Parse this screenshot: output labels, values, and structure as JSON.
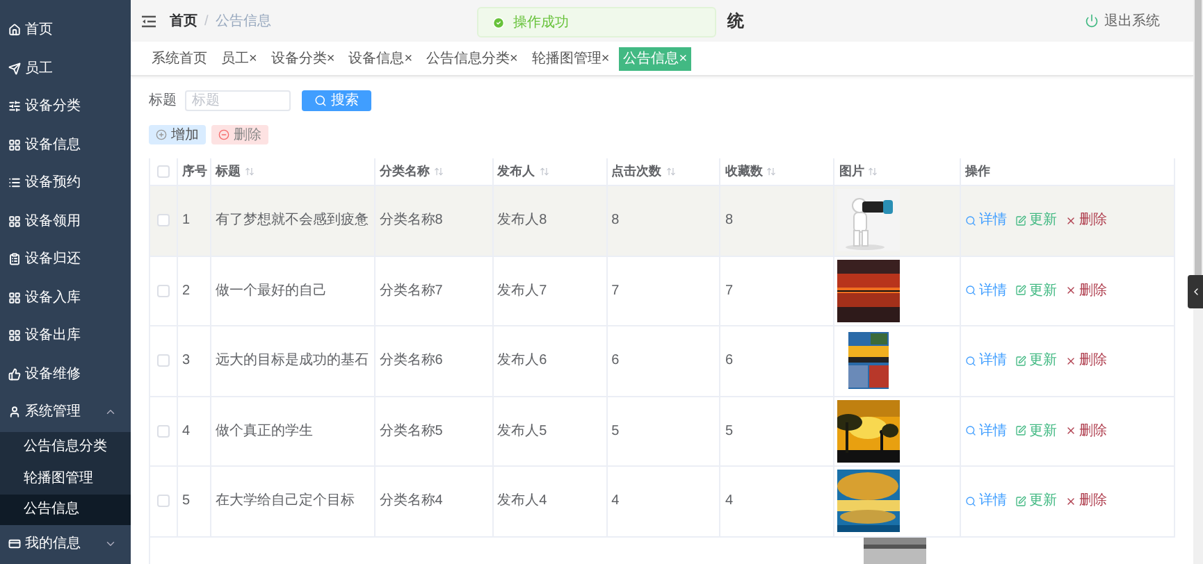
{
  "sidebar": {
    "items": [
      {
        "label": "首页",
        "selected": false
      },
      {
        "label": "员工",
        "selected": false
      },
      {
        "label": "设备分类",
        "selected": false
      },
      {
        "label": "设备信息",
        "selected": false
      },
      {
        "label": "设备预约",
        "selected": false
      },
      {
        "label": "设备领用",
        "selected": false
      },
      {
        "label": "设备归还",
        "selected": false
      },
      {
        "label": "设备入库",
        "selected": false
      },
      {
        "label": "设备出库",
        "selected": false
      },
      {
        "label": "设备维修",
        "selected": false
      },
      {
        "label": "系统管理",
        "selected": false,
        "expanded": true,
        "children": [
          {
            "label": "公告信息分类",
            "selected": false
          },
          {
            "label": "轮播图管理",
            "selected": false
          },
          {
            "label": "公告信息",
            "selected": true
          }
        ]
      },
      {
        "label": "我的信息",
        "selected": false,
        "expanded": false
      }
    ]
  },
  "header": {
    "breadcrumb": [
      {
        "label": "首页",
        "current": false
      },
      {
        "label": "公告信息",
        "current": true
      }
    ],
    "separator": "/",
    "title": "统",
    "logout": "退出系统"
  },
  "toast": {
    "message": "操作成功"
  },
  "tabs": [
    {
      "label": "系统首页",
      "selected": false
    },
    {
      "label": "员工",
      "close": "×",
      "selected": false
    },
    {
      "label": "设备分类",
      "close": "×",
      "selected": false
    },
    {
      "label": "设备信息",
      "close": "×",
      "selected": false
    },
    {
      "label": "公告信息分类",
      "close": "×",
      "selected": false
    },
    {
      "label": "轮播图管理",
      "close": "×",
      "selected": false
    },
    {
      "label": "公告信息",
      "close": "×",
      "selected": true
    }
  ],
  "search": {
    "label": "标题",
    "placeholder": "标题",
    "button": "搜索"
  },
  "toolbar": {
    "add": "增加",
    "delete": "删除"
  },
  "table": {
    "select_all_checked": false,
    "columns": [
      {
        "label": "序号",
        "sortable": false
      },
      {
        "label": "标题",
        "sortable": true
      },
      {
        "label": "分类名称",
        "sortable": true
      },
      {
        "label": "发布人",
        "sortable": true
      },
      {
        "label": "点击次数",
        "sortable": true
      },
      {
        "label": "收藏数",
        "sortable": true
      },
      {
        "label": "图片",
        "sortable": true
      },
      {
        "label": "操作",
        "sortable": false
      }
    ],
    "rows": [
      {
        "checked": false,
        "highlighted": true,
        "cells": [
          "1",
          "有了梦想就不会感到疲惫",
          "分类名称8",
          "发布人8",
          "8",
          "8"
        ],
        "picture": {
          "kind": "picture"
        },
        "actions": [
          "详情",
          "更新",
          "删除"
        ]
      },
      {
        "checked": false,
        "highlighted": false,
        "cells": [
          "2",
          "做一个最好的自己",
          "分类名称7",
          "发布人7",
          "7",
          "7"
        ],
        "picture": {
          "kind": "picture"
        },
        "actions": [
          "详情",
          "更新",
          "删除"
        ]
      },
      {
        "checked": false,
        "highlighted": false,
        "cells": [
          "3",
          "远大的目标是成功的基石",
          "分类名称6",
          "发布人6",
          "6",
          "6"
        ],
        "picture": {
          "kind": "picture"
        },
        "actions": [
          "详情",
          "更新",
          "删除"
        ]
      },
      {
        "checked": false,
        "highlighted": false,
        "cells": [
          "4",
          "做个真正的学生",
          "分类名称5",
          "发布人5",
          "5",
          "5"
        ],
        "picture": {
          "kind": "picture"
        },
        "actions": [
          "详情",
          "更新",
          "删除"
        ]
      },
      {
        "checked": false,
        "highlighted": false,
        "cells": [
          "5",
          "在大学给自己定个目标",
          "分类名称4",
          "发布人4",
          "4",
          "4"
        ],
        "picture": {
          "kind": "picture"
        },
        "actions": [
          "详情",
          "更新",
          "删除"
        ]
      }
    ],
    "next_row": {
      "picture": {
        "kind": "picture"
      }
    }
  }
}
